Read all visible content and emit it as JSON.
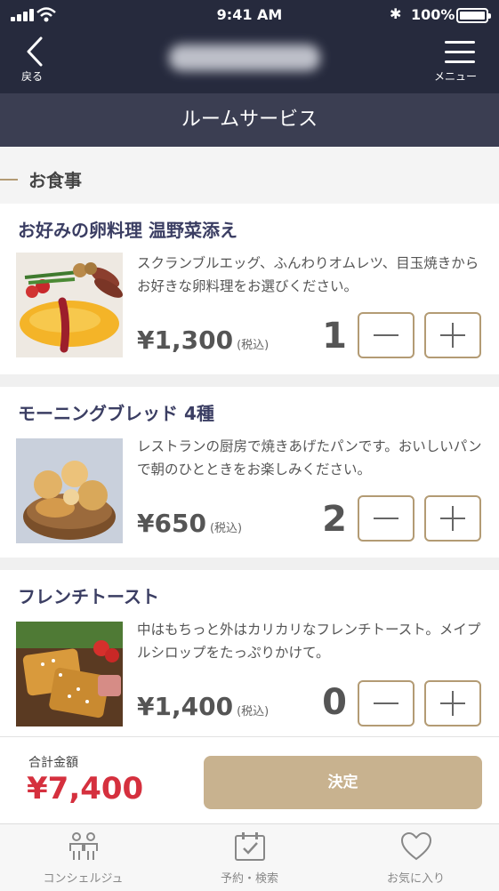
{
  "status_bar": {
    "time": "9:41 AM",
    "battery": "100%"
  },
  "header": {
    "back_label": "戻る",
    "menu_label": "メニュー",
    "page_title": "ルームサービス"
  },
  "section": {
    "title": "お食事"
  },
  "items": [
    {
      "name": "お好みの卵料理 温野菜添え",
      "description": "スクランブルエッグ、ふんわりオムレツ、目玉焼きからお好きな卵料理をお選びください。",
      "price": "¥1,300",
      "tax_label": "(税込)",
      "quantity": "1",
      "image_icon": "omelette-photo"
    },
    {
      "name": "モーニングブレッド 4種",
      "description": "レストランの厨房で焼きあげたパンです。おいしいパンで朝のひとときをお楽しみください。",
      "price": "¥650",
      "tax_label": "(税込)",
      "quantity": "2",
      "image_icon": "bread-basket-photo"
    },
    {
      "name": "フレンチトースト",
      "description": "中はもちっと外はカリカリなフレンチトースト。メイプルシロップをたっぷりかけて。",
      "price": "¥1,400",
      "tax_label": "(税込)",
      "quantity": "0",
      "image_icon": "french-toast-photo"
    }
  ],
  "footer": {
    "total_label": "合計金額",
    "total_amount": "¥7,400",
    "confirm_label": "決定"
  },
  "tabs": [
    {
      "label": "コンシェルジュ",
      "icon": "concierge-icon"
    },
    {
      "label": "予約・検索",
      "icon": "calendar-check-icon"
    },
    {
      "label": "お気に入り",
      "icon": "heart-icon"
    }
  ],
  "colors": {
    "header_bg": "#262a3d",
    "title_bg": "#3b3e52",
    "accent_gold": "#b39b74",
    "confirm_bg": "#c8b28f",
    "total_red": "#d5303e",
    "item_name": "#3b3e63"
  }
}
